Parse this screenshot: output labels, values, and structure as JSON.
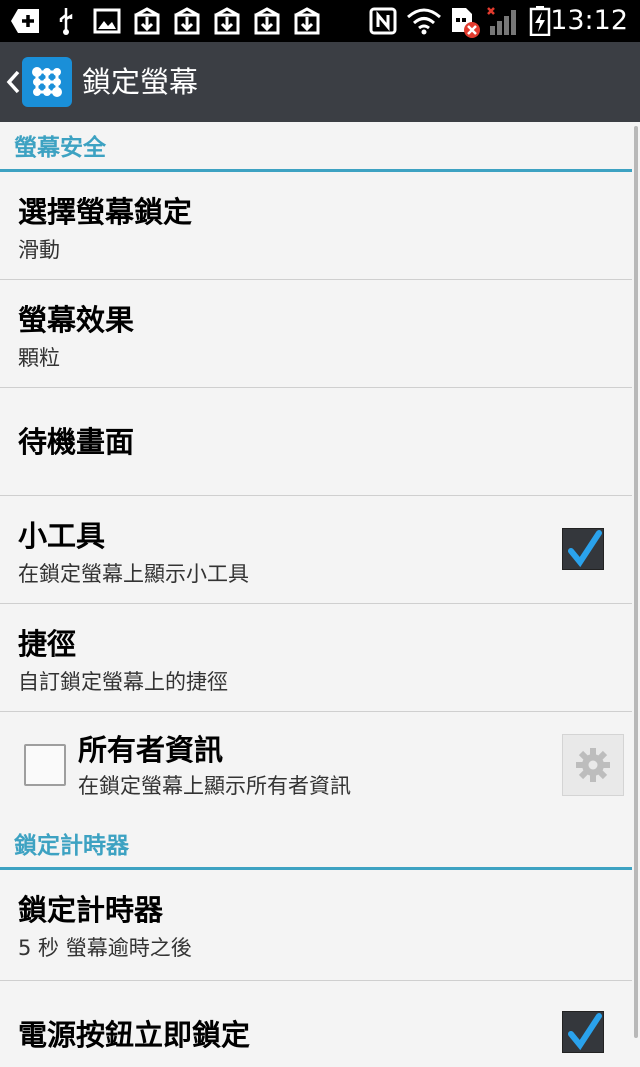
{
  "status_bar": {
    "time": "13:12",
    "icons": [
      "add-box-icon",
      "usb-icon",
      "image-icon",
      "download-icon",
      "download-icon",
      "download-icon",
      "download-icon",
      "download-icon",
      "nfc-icon",
      "wifi-icon",
      "sim-error-icon",
      "signal-icon",
      "battery-charging-icon"
    ]
  },
  "app_bar": {
    "title": "鎖定螢幕"
  },
  "sections": [
    {
      "header": "螢幕安全"
    },
    {
      "header": "鎖定計時器"
    }
  ],
  "items": [
    {
      "title": "選擇螢幕鎖定",
      "subtitle": "滑動"
    },
    {
      "title": "螢幕效果",
      "subtitle": "顆粒"
    },
    {
      "title": "待機畫面"
    },
    {
      "title": "小工具",
      "subtitle": "在鎖定螢幕上顯示小工具",
      "checked": true
    },
    {
      "title": "捷徑",
      "subtitle": "自訂鎖定螢幕上的捷徑"
    },
    {
      "title": "所有者資訊",
      "subtitle": "在鎖定螢幕上顯示所有者資訊",
      "checked": false
    },
    {
      "title": "鎖定計時器",
      "subtitle": "5 秒 螢幕逾時之後"
    },
    {
      "title": "電源按鈕立即鎖定",
      "checked": true
    }
  ],
  "colors": {
    "accent": "#3da2c2",
    "app_bar": "#3b3e44",
    "background": "#f4f4f4"
  }
}
